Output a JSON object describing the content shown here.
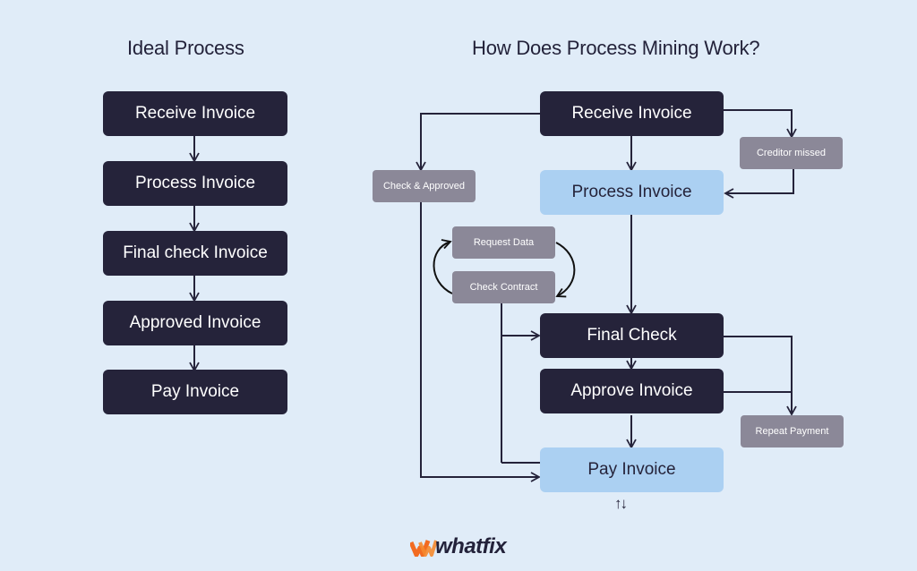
{
  "left": {
    "title": "Ideal Process",
    "steps": [
      "Receive Invoice",
      "Process Invoice",
      "Final check Invoice",
      "Approved Invoice",
      "Pay Invoice"
    ]
  },
  "right": {
    "title": "How Does Process Mining Work?",
    "main": {
      "receive": "Receive Invoice",
      "process": "Process Invoice",
      "final_check": "Final Check",
      "approve": "Approve Invoice",
      "pay": "Pay Invoice"
    },
    "side": {
      "check_approved": "Check & Approved",
      "creditor_missed": "Creditor missed",
      "request_data": "Request Data",
      "check_contract": "Check Contract",
      "repeat_payment": "Repeat Payment"
    },
    "bidirectional_glyph": "↑↓"
  },
  "colors": {
    "dark_node": "#25233a",
    "light_node": "#abd0f2",
    "grey_node": "#8b8898",
    "background": "#e0ecf8",
    "brand_orange": "#f26b21"
  },
  "brand": {
    "name": "whatfix"
  }
}
